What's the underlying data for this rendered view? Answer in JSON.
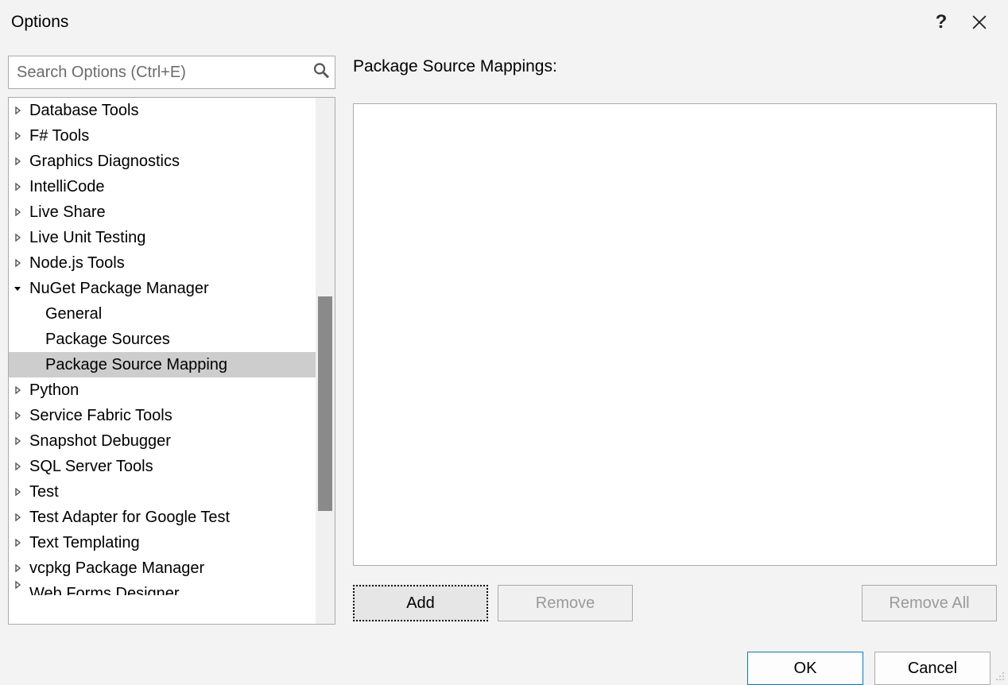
{
  "window": {
    "title": "Options"
  },
  "search": {
    "placeholder": "Search Options (Ctrl+E)"
  },
  "tree": {
    "items": [
      {
        "label": "Database Tools",
        "type": "parent",
        "expanded": false
      },
      {
        "label": "F# Tools",
        "type": "parent",
        "expanded": false
      },
      {
        "label": "Graphics Diagnostics",
        "type": "parent",
        "expanded": false
      },
      {
        "label": "IntelliCode",
        "type": "parent",
        "expanded": false
      },
      {
        "label": "Live Share",
        "type": "parent",
        "expanded": false
      },
      {
        "label": "Live Unit Testing",
        "type": "parent",
        "expanded": false
      },
      {
        "label": "Node.js Tools",
        "type": "parent",
        "expanded": false
      },
      {
        "label": "NuGet Package Manager",
        "type": "parent",
        "expanded": true
      },
      {
        "label": "General",
        "type": "child"
      },
      {
        "label": "Package Sources",
        "type": "child"
      },
      {
        "label": "Package Source Mapping",
        "type": "child",
        "selected": true
      },
      {
        "label": "Python",
        "type": "parent",
        "expanded": false
      },
      {
        "label": "Service Fabric Tools",
        "type": "parent",
        "expanded": false
      },
      {
        "label": "Snapshot Debugger",
        "type": "parent",
        "expanded": false
      },
      {
        "label": "SQL Server Tools",
        "type": "parent",
        "expanded": false
      },
      {
        "label": "Test",
        "type": "parent",
        "expanded": false
      },
      {
        "label": "Test Adapter for Google Test",
        "type": "parent",
        "expanded": false
      },
      {
        "label": "Text Templating",
        "type": "parent",
        "expanded": false
      },
      {
        "label": "vcpkg Package Manager",
        "type": "parent",
        "expanded": false
      },
      {
        "label": "Web Forms Designer",
        "type": "parent",
        "expanded": false,
        "cutoff": true
      }
    ]
  },
  "panel": {
    "heading": "Package Source Mappings:",
    "buttons": {
      "add": "Add",
      "remove": "Remove",
      "remove_all": "Remove All"
    }
  },
  "footer": {
    "ok": "OK",
    "cancel": "Cancel"
  }
}
